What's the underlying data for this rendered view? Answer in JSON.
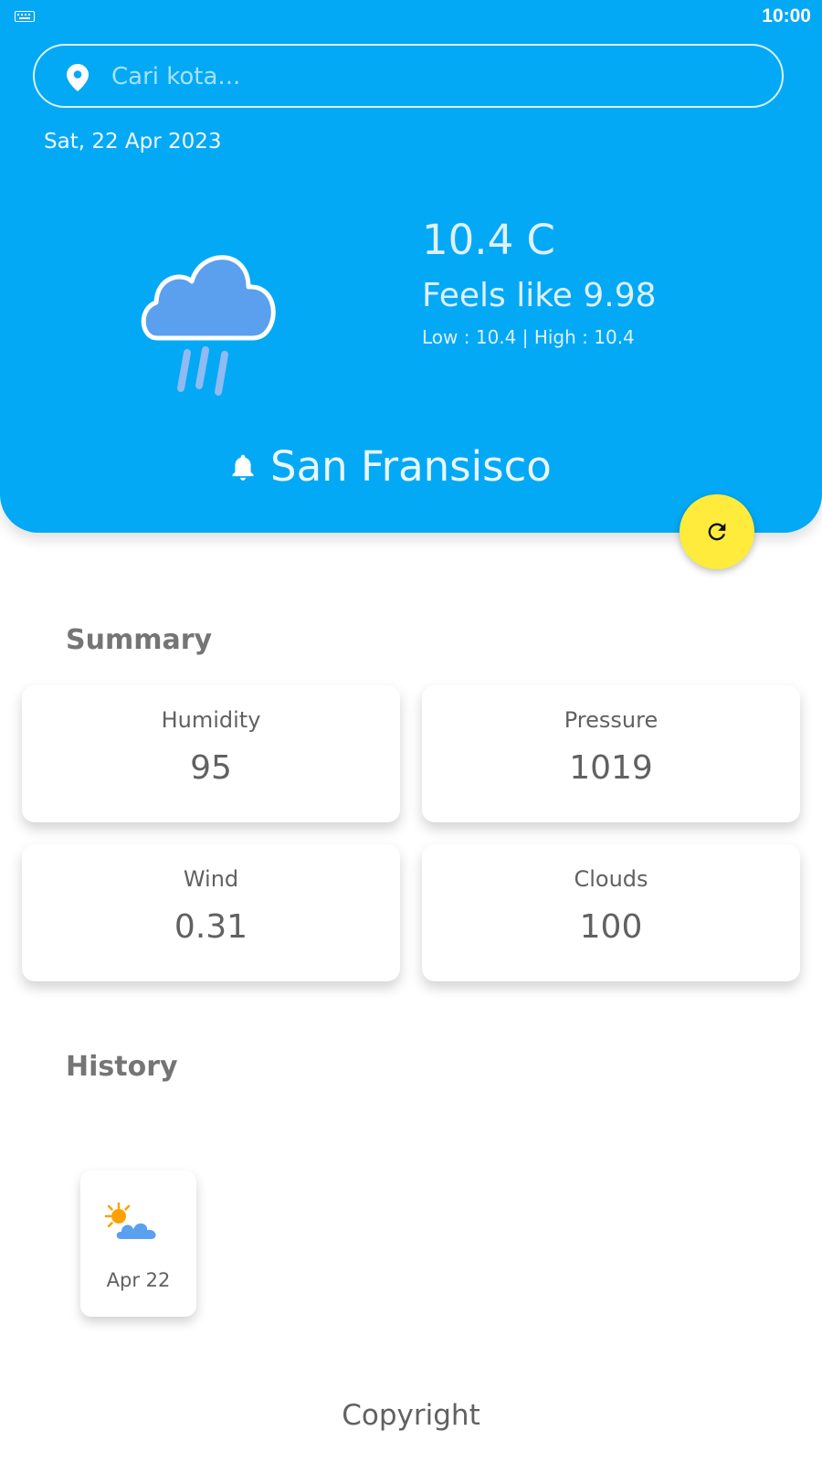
{
  "status_bar": {
    "time": "10:00",
    "keyboard_icon": "keyboard-icon"
  },
  "search": {
    "placeholder": "Cari kota...",
    "value": "",
    "icon": "location-pin-icon"
  },
  "date": "Sat, 22 Apr 2023",
  "weather": {
    "icon": "rain-cloud-icon",
    "temperature": "10.4 C",
    "feels_like": "Feels like 9.98",
    "low_high": "Low : 10.4 | High : 10.4"
  },
  "location": {
    "icon": "bell-icon",
    "city": "San Fransisco"
  },
  "refresh_button": {
    "icon": "refresh-icon",
    "color": "#FFEB3B"
  },
  "summary": {
    "title": "Summary",
    "items": [
      {
        "label": "Humidity",
        "value": "95"
      },
      {
        "label": "Pressure",
        "value": "1019"
      },
      {
        "label": "Wind",
        "value": "0.31"
      },
      {
        "label": "Clouds",
        "value": "100"
      }
    ]
  },
  "history": {
    "title": "History",
    "items": [
      {
        "icon": "partly-cloudy-icon",
        "date": "Apr 22"
      }
    ]
  },
  "footer": {
    "text": "Copyright"
  },
  "colors": {
    "header_bg": "#03A9F4",
    "accent": "#FFEB3B",
    "cloud": "#5B9FEF",
    "sun": "#FFA000"
  }
}
